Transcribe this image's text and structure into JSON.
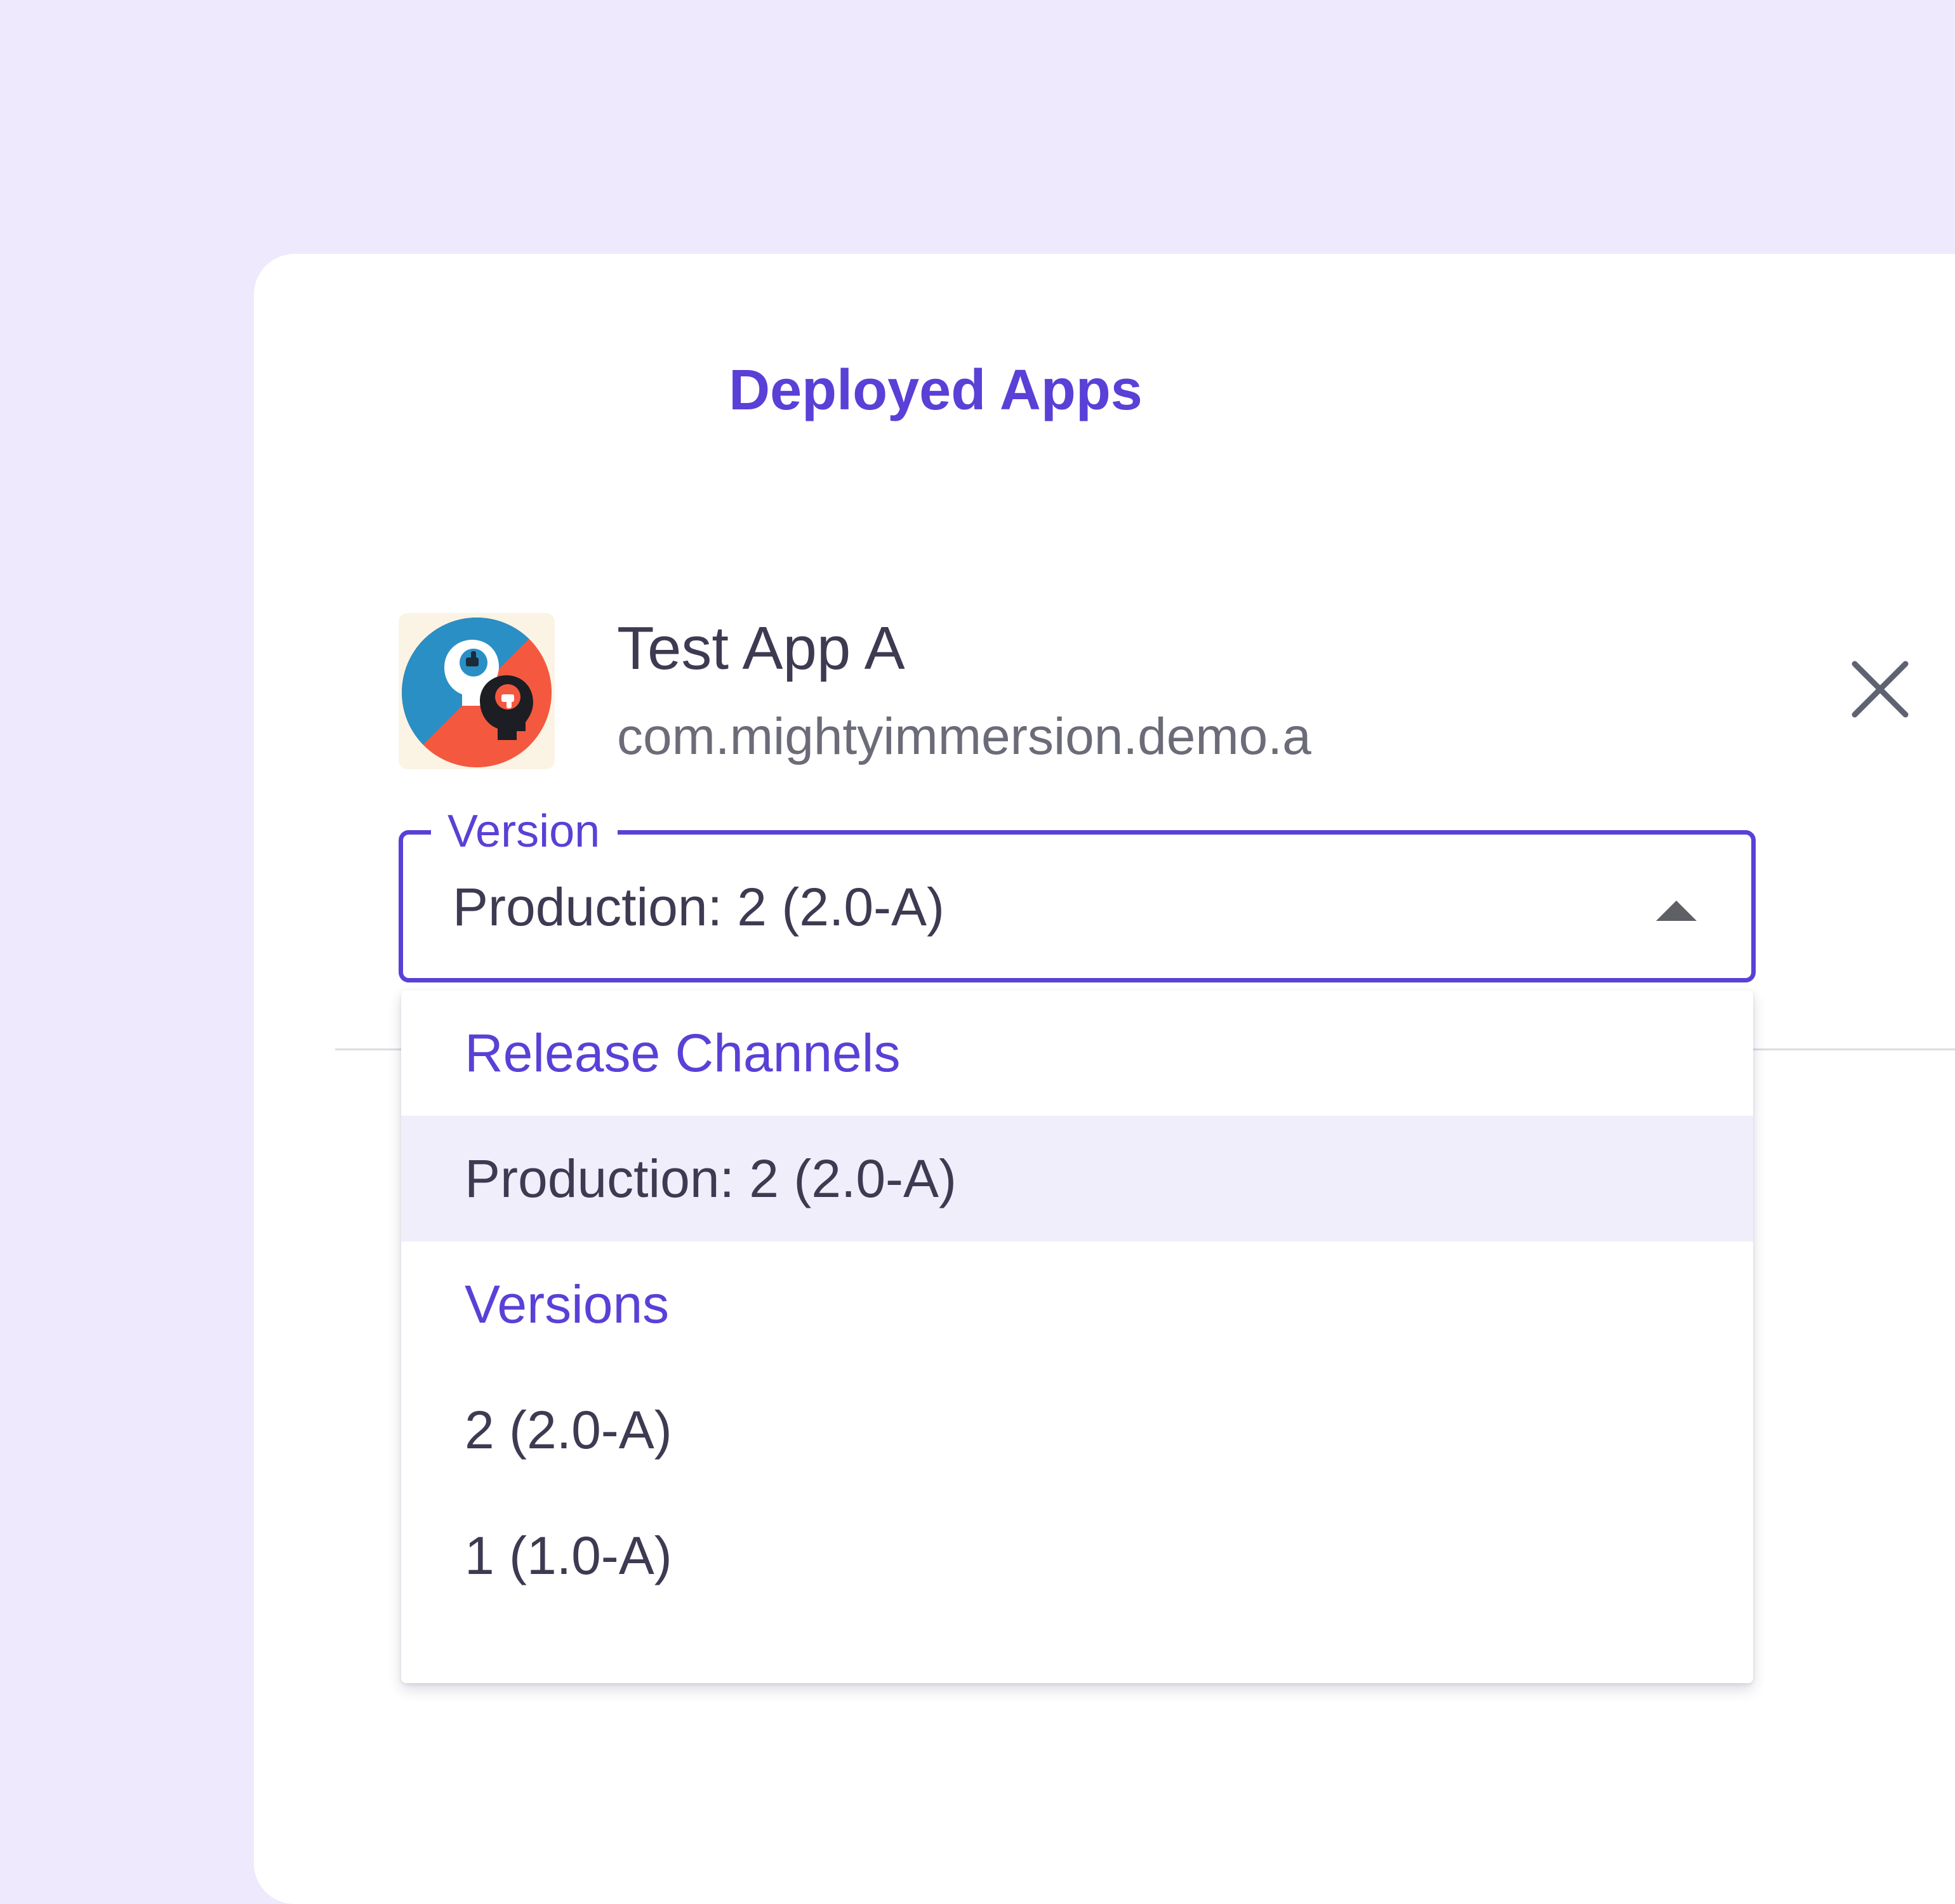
{
  "dialog": {
    "title": "Deployed Apps"
  },
  "app": {
    "name": "Test App A",
    "package": "com.mightyimmersion.demo.a",
    "icon": "app-icon-brains",
    "close_icon": "close-icon"
  },
  "version_select": {
    "label": "Version",
    "value": "Production: 2 (2.0-A)",
    "arrow_icon": "arrow-up-icon"
  },
  "dropdown": {
    "groups": [
      {
        "header": "Release Channels",
        "options": [
          {
            "label": "Production: 2 (2.0-A)",
            "selected": true
          }
        ]
      },
      {
        "header": "Versions",
        "options": [
          {
            "label": "2 (2.0-A)",
            "selected": false
          },
          {
            "label": "1 (1.0-A)",
            "selected": false
          }
        ]
      }
    ]
  },
  "colors": {
    "page_background": "#eee9fd",
    "accent": "#5a40d6",
    "text_primary": "#3d3a52",
    "text_secondary": "#6b6c78",
    "selected_row": "#f1eefb",
    "icon_blue": "#2a8fc4",
    "icon_red": "#f4583f"
  }
}
